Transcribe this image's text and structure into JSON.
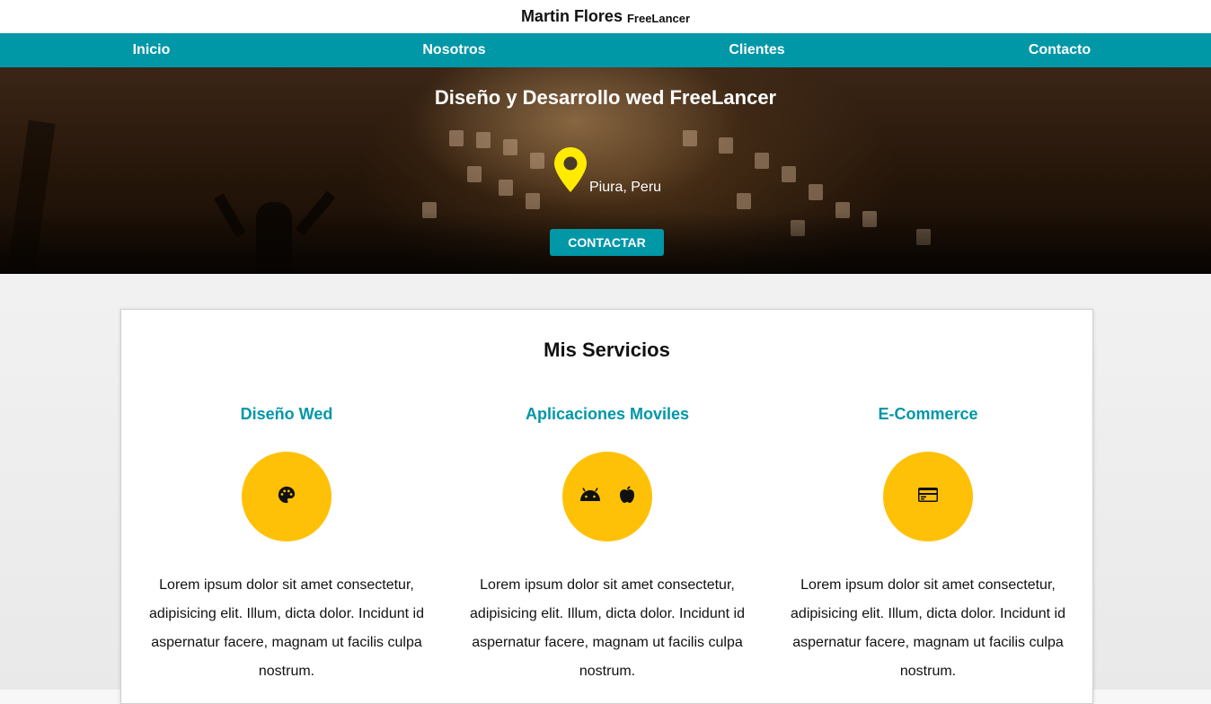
{
  "header": {
    "name": "Martin Flores",
    "tagline": "FreeLancer"
  },
  "nav": {
    "items": [
      {
        "label": "Inicio"
      },
      {
        "label": "Nosotros"
      },
      {
        "label": "Clientes"
      },
      {
        "label": "Contacto"
      }
    ]
  },
  "hero": {
    "title": "Diseño y Desarrollo wed FreeLancer",
    "location": "Piura, Peru",
    "cta": "CONTACTAR",
    "pin_color": "#ffeb00"
  },
  "services": {
    "title": "Mis Servicios",
    "items": [
      {
        "title": "Diseño Wed",
        "icons": [
          "palette-icon"
        ],
        "text": "Lorem ipsum dolor sit amet consectetur, adipisicing elit. Illum, dicta dolor. Incidunt id aspernatur facere, magnam ut facilis culpa nostrum."
      },
      {
        "title": "Aplicaciones Moviles",
        "icons": [
          "android-icon",
          "apple-icon"
        ],
        "text": "Lorem ipsum dolor sit amet consectetur, adipisicing elit. Illum, dicta dolor. Incidunt id aspernatur facere, magnam ut facilis culpa nostrum."
      },
      {
        "title": "E-Commerce",
        "icons": [
          "credit-card-icon"
        ],
        "text": "Lorem ipsum dolor sit amet consectetur, adipisicing elit. Illum, dicta dolor. Incidunt id aspernatur facere, magnam ut facilis culpa nostrum."
      }
    ]
  },
  "colors": {
    "accent": "#0097a7",
    "icon_circle": "#ffc107",
    "pin": "#ffeb00"
  }
}
